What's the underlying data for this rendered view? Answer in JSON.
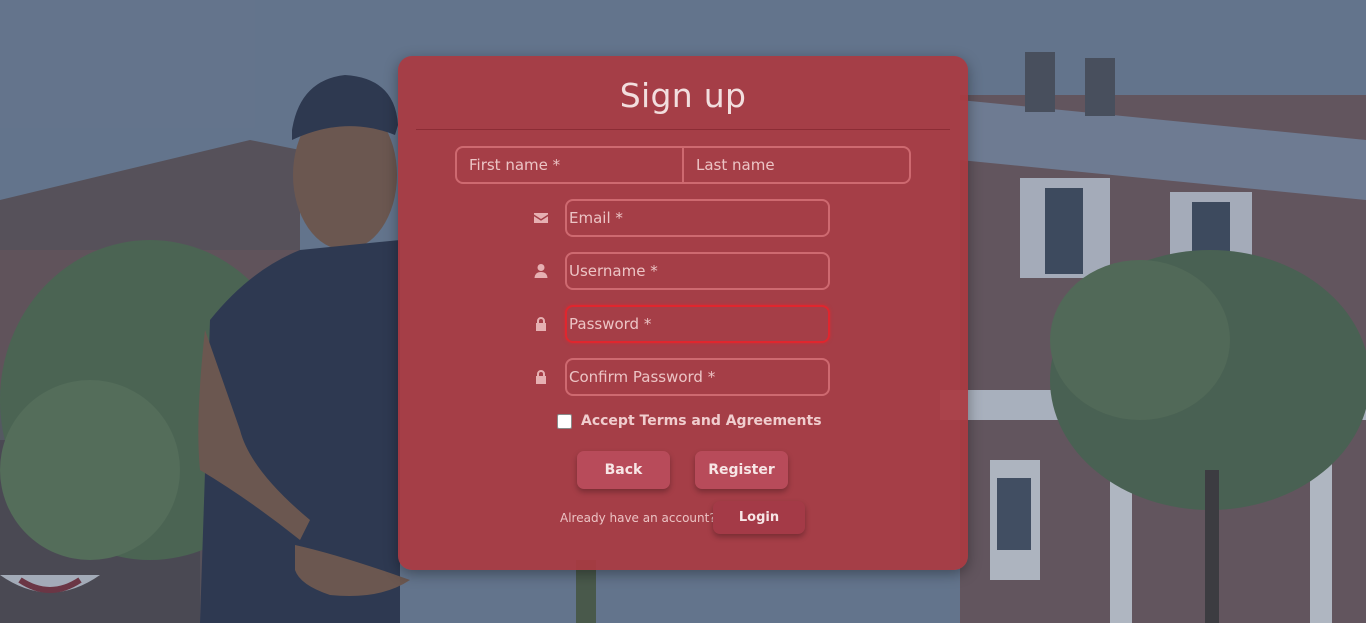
{
  "form": {
    "title": "Sign up",
    "first_name_placeholder": "First name *",
    "last_name_placeholder": "Last name",
    "email_placeholder": "Email *",
    "username_placeholder": "Username *",
    "password_placeholder": "Password *",
    "confirm_password_placeholder": "Confirm Password *",
    "terms_label": "Accept Terms and Agreements",
    "terms_checked": false,
    "back_label": "Back",
    "register_label": "Register",
    "already_text": "Already have an account?",
    "login_label": "Login"
  },
  "icons": {
    "email": "envelope-icon",
    "username": "user-icon",
    "password": "lock-icon",
    "confirm_password": "lock-icon"
  },
  "colors": {
    "card_background": "#aa3a42",
    "focused_border": "#e0262e",
    "button_background": "#b84b5a"
  }
}
